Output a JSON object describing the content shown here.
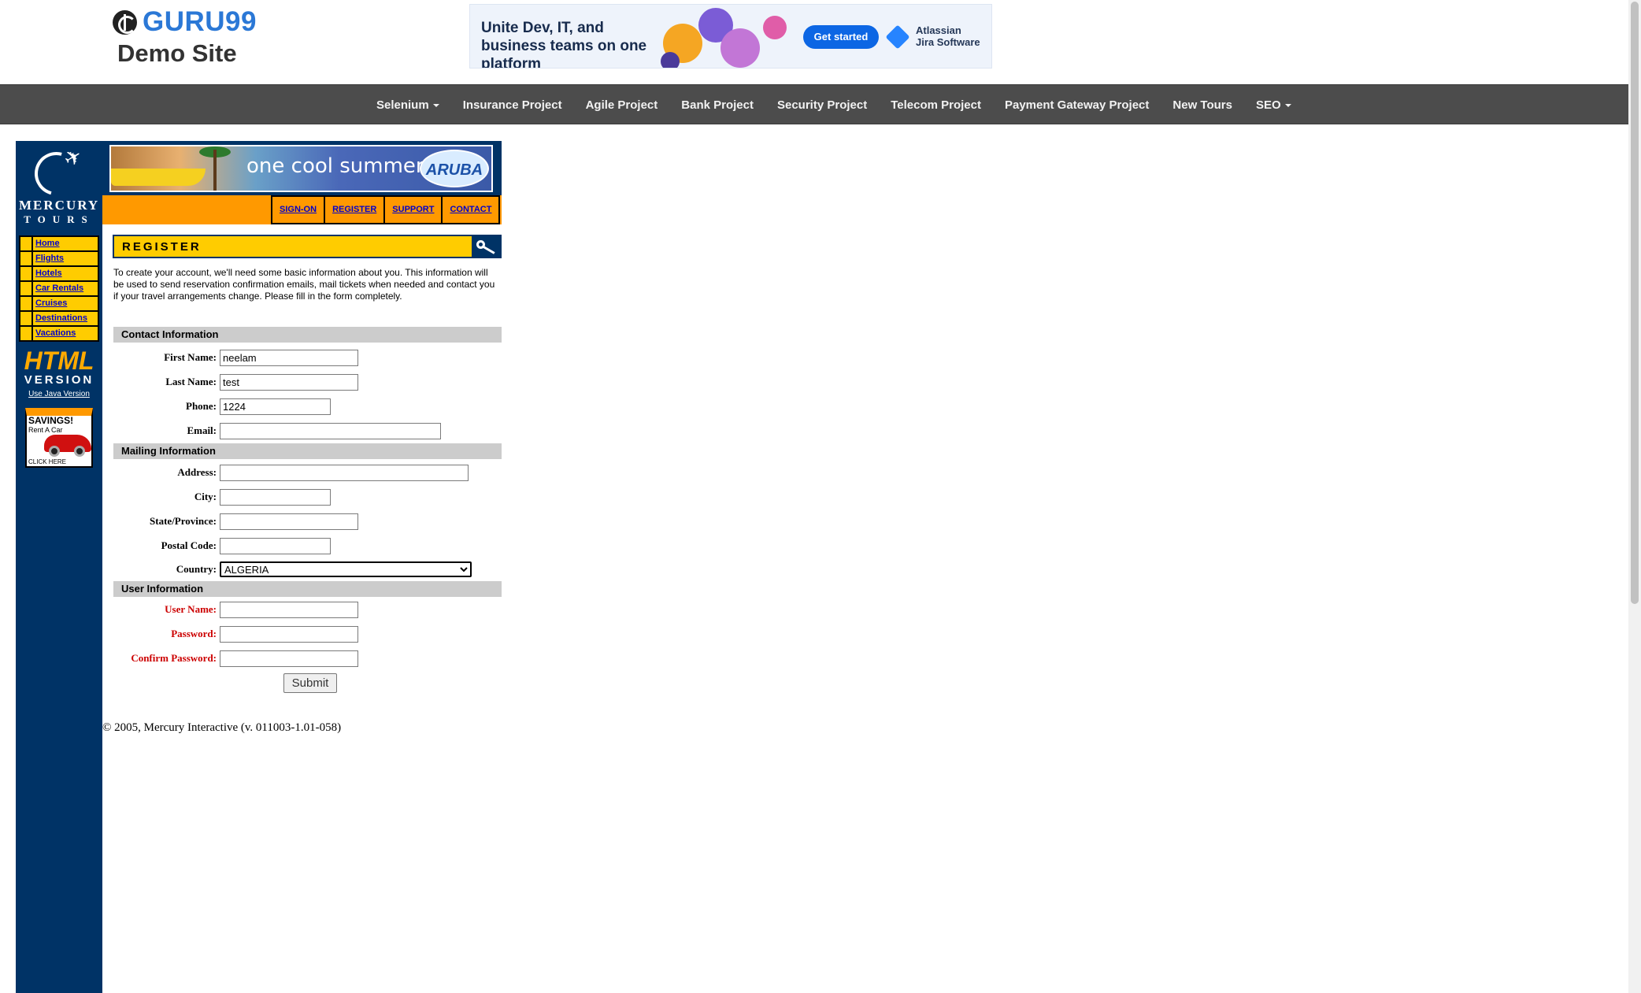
{
  "header": {
    "brand": "GURU99",
    "subtitle": "Demo Site"
  },
  "ad": {
    "headline": "Unite Dev, IT, and business teams on one platform",
    "button": "Get started",
    "product_line1": "Atlassian",
    "product_line2": "Jira Software"
  },
  "topnav": {
    "items": [
      "Selenium",
      "Insurance Project",
      "Agile Project",
      "Bank Project",
      "Security Project",
      "Telecom Project",
      "Payment Gateway Project",
      "New Tours",
      "SEO"
    ]
  },
  "mercury": {
    "logo_name": "MERCURY",
    "logo_sub": "TOURS",
    "banner_text": "one cool summer",
    "banner_brand": "ARUBA",
    "nav": [
      "SIGN-ON",
      "REGISTER",
      "SUPPORT",
      "CONTACT"
    ],
    "side_nav": [
      "Home",
      "Flights",
      "Hotels",
      "Car Rentals",
      "Cruises",
      "Destinations",
      "Vacations"
    ],
    "html_label": "HTML",
    "version_label": "VERSION",
    "java_link": "Use Java Version",
    "savings_title": "SAVINGS!",
    "savings_sub": "Rent A Car",
    "savings_click": "CLICK HERE"
  },
  "register": {
    "title": "REGISTER",
    "intro": "To create your account, we'll need some basic information about you. This information will be used to send reservation confirmation emails, mail tickets when needed and contact you if your travel arrangements change. Please fill in the form completely.",
    "contact_section": "Contact Information",
    "mailing_section": "Mailing Information",
    "user_section": "User Information",
    "labels": {
      "first_name": "First Name:",
      "last_name": "Last Name:",
      "phone": "Phone:",
      "email": "Email:",
      "address": "Address:",
      "city": "City:",
      "state": "State/Province:",
      "postal": "Postal Code:",
      "country": "Country:",
      "username": "User Name:",
      "password": "Password:",
      "confirm": "Confirm Password:"
    },
    "values": {
      "first_name": "neelam",
      "last_name": "test",
      "phone": "1224",
      "email": "",
      "address": "",
      "city": "",
      "state": "",
      "postal": "",
      "country": "ALGERIA",
      "username": "",
      "password": "",
      "confirm": ""
    },
    "submit": "Submit"
  },
  "footer": {
    "copyright": "© 2005, Mercury Interactive (v. 011003-1.01-058)"
  }
}
